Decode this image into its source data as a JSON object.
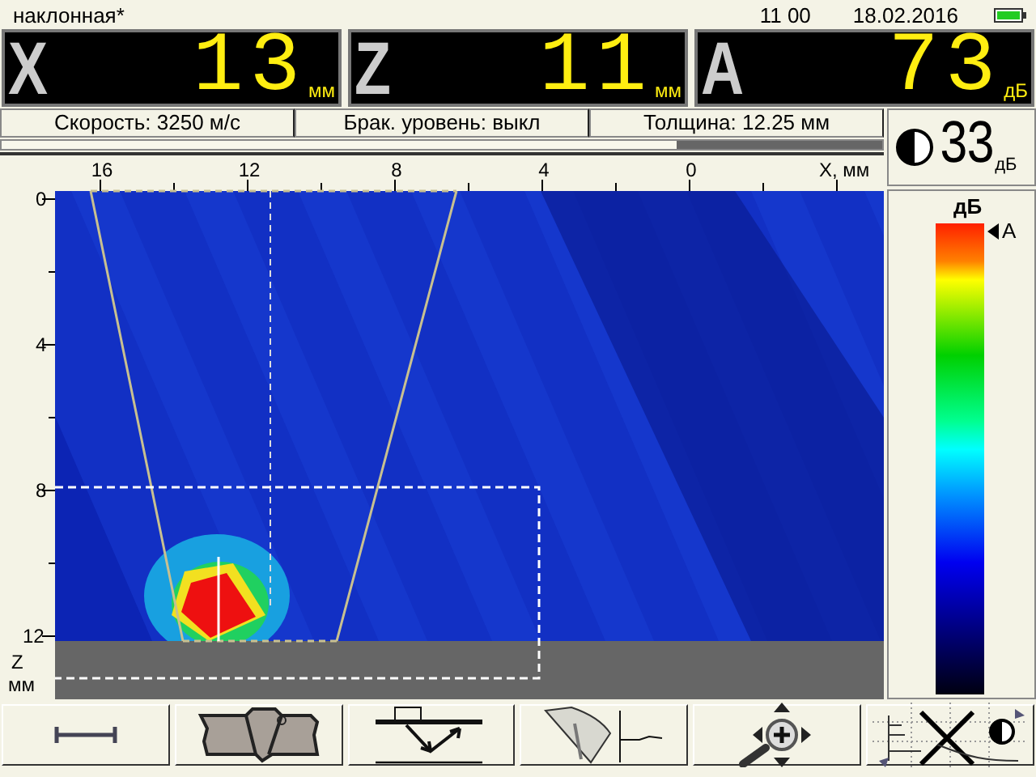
{
  "header": {
    "title": "наклонная*",
    "time": "11 00",
    "date": "18.02.2016"
  },
  "readouts": [
    {
      "label": "X",
      "value": "13",
      "unit": "мм"
    },
    {
      "label": "Z",
      "value": "11",
      "unit": "мм"
    },
    {
      "label": "A",
      "value": "73",
      "unit": "дБ"
    }
  ],
  "info": [
    "Скорость: 3250 м/с",
    "Брак. уровень: выкл",
    "Толщина: 12.25 мм"
  ],
  "gain": {
    "value": "33",
    "unit": "дБ"
  },
  "scan": {
    "x_ticks": [
      "16",
      "12",
      "8",
      "4",
      "0"
    ],
    "x_label": "X, мм",
    "z_ticks": [
      "0",
      "4",
      "8",
      "12"
    ],
    "z_label": "Z",
    "z_unit": "мм"
  },
  "color_scale": {
    "unit": "дБ",
    "marker": "A"
  },
  "toolbar": [
    {
      "kind": "ruler"
    },
    {
      "kind": "weld"
    },
    {
      "kind": "beam"
    },
    {
      "kind": "sector"
    },
    {
      "kind": "zoom"
    },
    {
      "kind": "display"
    }
  ]
}
